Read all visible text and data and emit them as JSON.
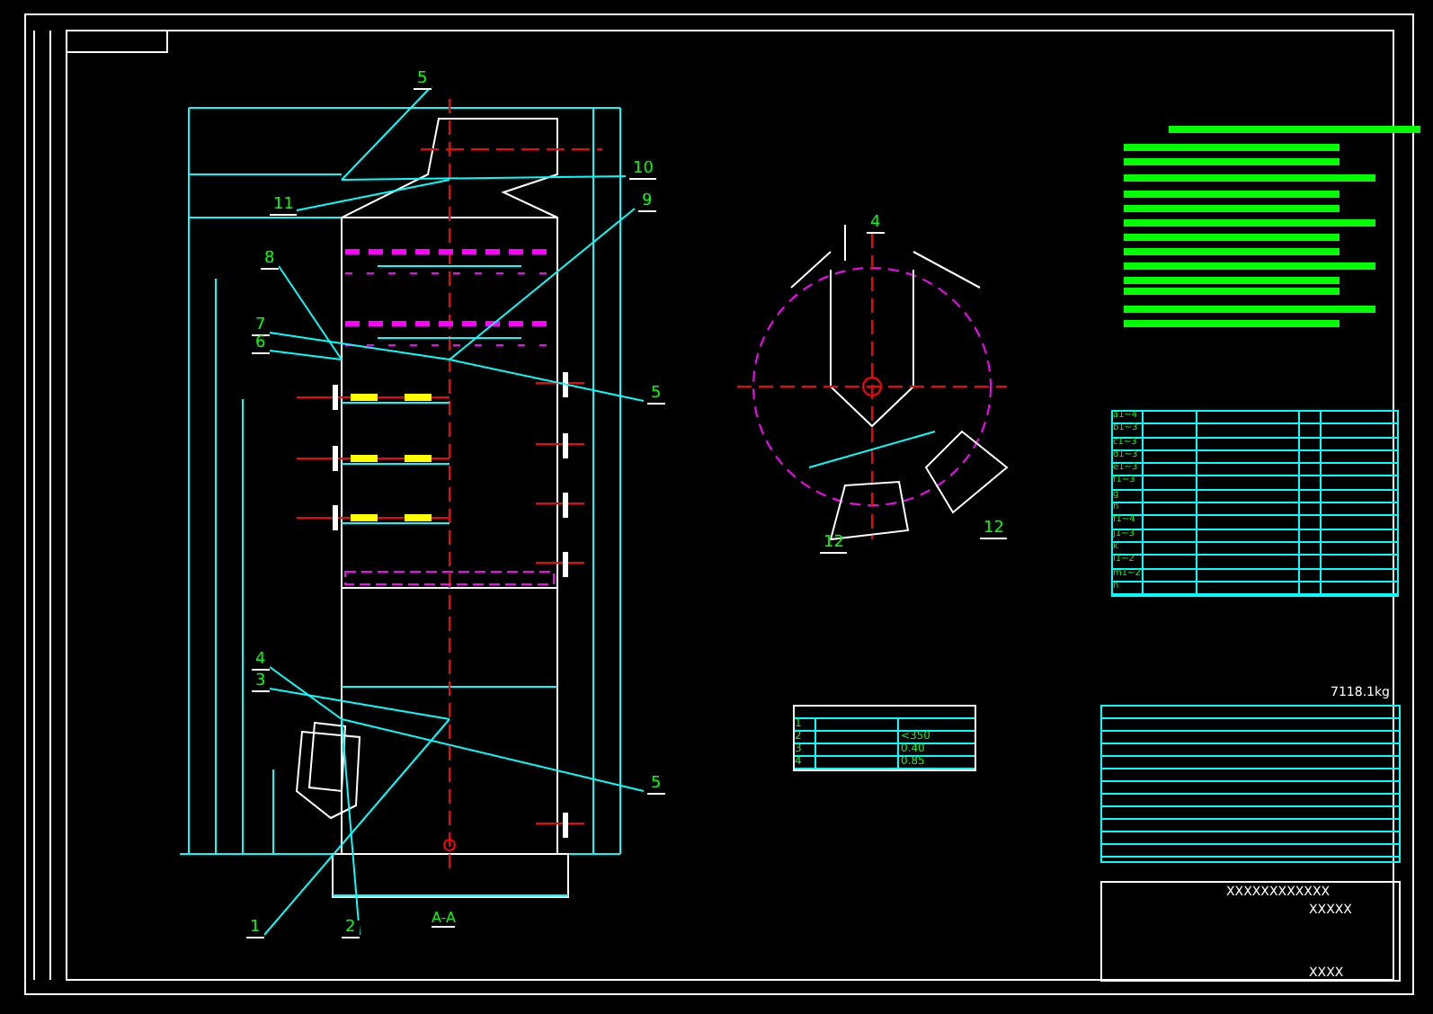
{
  "sheet": {
    "section_label": "A-A",
    "weight": "7118.1kg"
  },
  "left_view": {
    "callouts": [
      {
        "label": "5"
      },
      {
        "label": "11"
      },
      {
        "label": "10"
      },
      {
        "label": "9"
      },
      {
        "label": "8"
      },
      {
        "label": "7"
      },
      {
        "label": "6"
      },
      {
        "label": "5"
      },
      {
        "label": "4"
      },
      {
        "label": "3"
      },
      {
        "label": "5"
      },
      {
        "label": "1"
      },
      {
        "label": "2"
      }
    ]
  },
  "section_view": {
    "callouts": [
      {
        "label": "4"
      },
      {
        "label": "12"
      },
      {
        "label": "12"
      }
    ]
  },
  "nozzle_table": {
    "marks": [
      "a1~4",
      "b1~3",
      "c1~3",
      "d1~3",
      "e1~3",
      "f1~3",
      "g",
      "h",
      "f1~4",
      "j1~3",
      "k",
      "l1~2",
      "m1~2",
      "n"
    ]
  },
  "small_table": {
    "rows": [
      {
        "no": "1"
      },
      {
        "no": "2",
        "value": "<350"
      },
      {
        "no": "3",
        "value": "0.40"
      },
      {
        "no": "4",
        "value": "0.85"
      }
    ]
  },
  "title_block": {
    "project": "XXXXXXXXXXXX",
    "name": "XXXXX",
    "code": "XXXX"
  }
}
